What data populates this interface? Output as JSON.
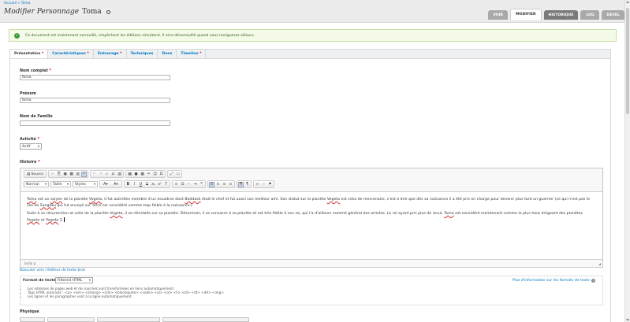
{
  "breadcrumb": "Accueil » Toma",
  "title": {
    "prefix": "Modifier Personnage",
    "name": "Toma"
  },
  "tabs": [
    "VOIR",
    "MODIFIER",
    "HISTORIQUE",
    "LOG",
    "DEVEL"
  ],
  "message": "Ce document est maintenant verrouillé, empêchant les éditions simultané. Il sera déverrouillé quand vous naviguerez ailleurs.",
  "vtabs": [
    {
      "label": "Présentation",
      "req": "*"
    },
    {
      "label": "Caractéristiques",
      "req": "*"
    },
    {
      "label": "Entourage",
      "req": "*"
    },
    {
      "label": "Techniques",
      "req": ""
    },
    {
      "label": "Dons",
      "req": ""
    },
    {
      "label": "Timeline",
      "req": "*"
    }
  ],
  "fields": {
    "nom_complet": {
      "label": "Nom complet",
      "req": "*",
      "value": "Toma"
    },
    "prenom": {
      "label": "Prénom",
      "value": "Toma"
    },
    "nom_famille": {
      "label": "Nom de Famille",
      "value": ""
    },
    "activite": {
      "label": "Activité",
      "req": "*",
      "value": "Actif"
    },
    "histoire": {
      "label": "Histoire",
      "req": "*"
    }
  },
  "editor": {
    "source": "Source",
    "format_combo": "Normal",
    "size_combo": "Taille",
    "styles_combo": "Styles",
    "p1": {
      "a1": "Toma",
      "a2": " est un ",
      "a3": "saiyen",
      "a4": " de la planète ",
      "a5": "Vegeta",
      "a6": ". Il fut autrefois membre d'un escadron dont ",
      "a7": "Baddack",
      "a8": " était le chef et fut aussi son meilleur ami. Son statut sur la planète ",
      "a9": "Vegeta",
      "a10": " est celui de mercenaire, c'est à dire que dès sa naissance il a été pris en charge pour devenir plus tard un guerrier (ce qui n'est pas le cas de ",
      "a11": "Sangoku",
      "a12": " qui fut envoyé sur Terre car considéré comme trop faible à la naissance.)"
    },
    "p2": {
      "b1": "Suite à sa résurrection et celle de la planète ",
      "b2": "Vegeta",
      "b3": ", il se réinstalla sur sa planète. Désormais, il se consacre à sa planète et est très fidèle à son roi, qui l'a d'ailleurs nommé général des armées. Le roi ayant pris plus de recul, ",
      "b4": "Toma",
      "b5": " est considéré maintenant comme le plus haut dirigeant des planètes ",
      "b6": "Vegeta",
      "b7": " et ",
      "b8": "Vegeta",
      "b9": " 2."
    },
    "path": "body  p"
  },
  "switch_link": "Basculer vers l'éditeur de texte brut",
  "text_format": {
    "label": "Format de texte",
    "value": "Filtered HTML",
    "more_info": "Plus d'information sur les formats de texte",
    "tips": [
      "Les adresses de pages web et de courriels sont transformées en liens automatiquement.",
      "Tags HTML autorisés : <a> <em> <strong> <cite> <blockquote> <code> <ul> <ol> <li> <dl> <dt> <dd> <img>",
      "Les lignes et les paragraphes vont à la ligne automatiquement."
    ]
  },
  "physique": "Physique"
}
